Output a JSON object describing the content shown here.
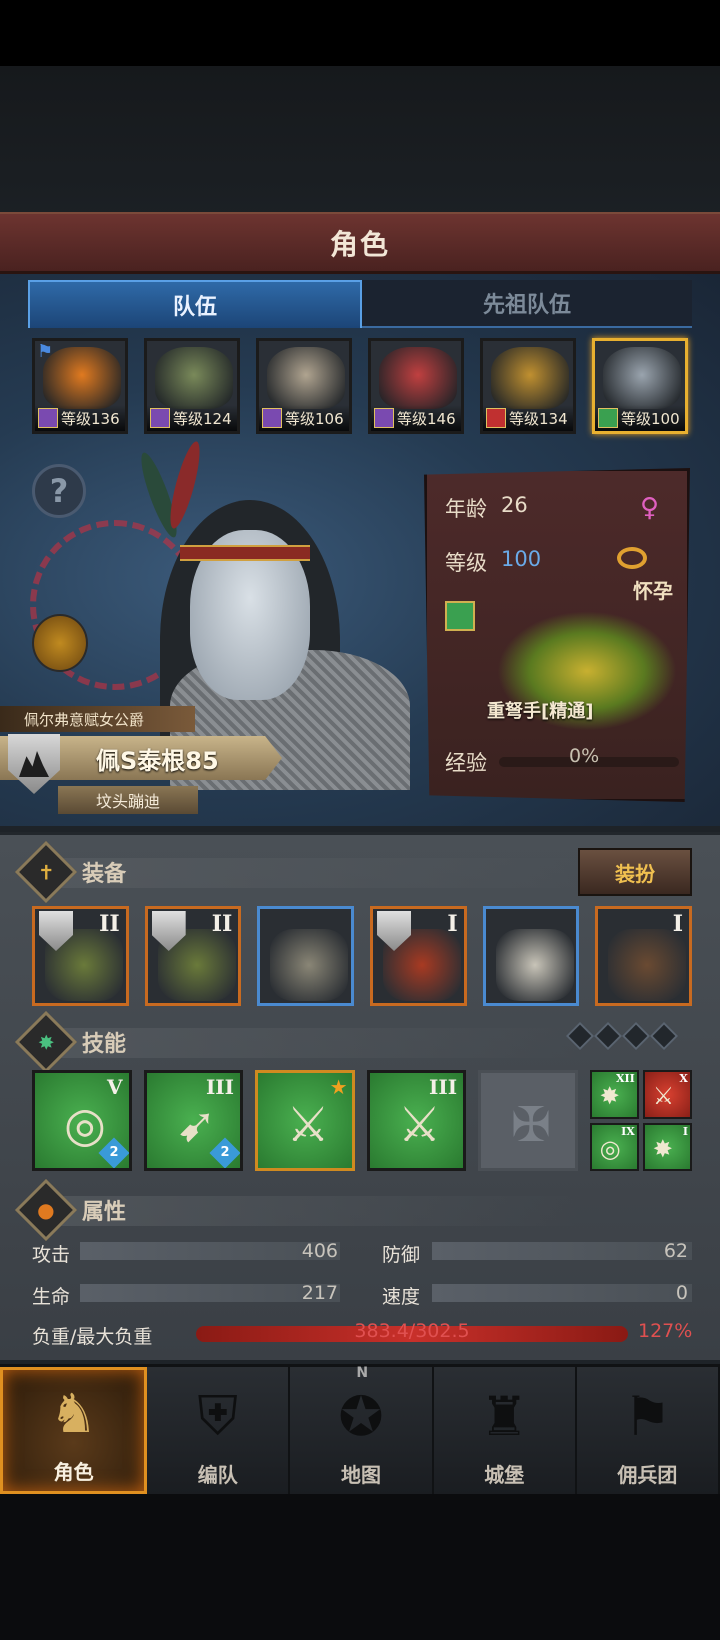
{
  "header": {
    "title": "角色"
  },
  "tabs": [
    {
      "label": "队伍",
      "active": true
    },
    {
      "label": "先祖队伍",
      "active": false
    }
  ],
  "party": [
    {
      "level_text": "等级136",
      "class_color": "#7a4ab0",
      "face_color": "#e07a20",
      "flag": true
    },
    {
      "level_text": "等级124",
      "class_color": "#7a4ab0",
      "face_color": "#7a8a5a",
      "flag": false
    },
    {
      "level_text": "等级106",
      "class_color": "#7a4ab0",
      "face_color": "#b0a490",
      "flag": false
    },
    {
      "level_text": "等级146",
      "class_color": "#7a4ab0",
      "face_color": "#c04040",
      "flag": false
    },
    {
      "level_text": "等级134",
      "class_color": "#c03030",
      "face_color": "#c09030",
      "flag": false
    },
    {
      "level_text": "等级100",
      "class_color": "#3aa050",
      "face_color": "#9aa4ae",
      "flag": false,
      "selected": true
    }
  ],
  "hero": {
    "help_icon": "?",
    "title": "佩尔弗意赋女公爵",
    "name": "佩S泰根85",
    "house": "坟头蹦迪"
  },
  "info": {
    "age_label": "年龄",
    "age": "26",
    "level_label": "等级",
    "level": "100",
    "gender_icon": "♀",
    "status": "怀孕",
    "class_name": "重弩手[精通]",
    "exp_label": "经验",
    "exp_pct": "0%",
    "exp_fraction": 0
  },
  "equipment": {
    "title": "装备",
    "dress_button": "装扮",
    "slots": [
      {
        "roman": "II",
        "shield": true,
        "rarity": "orange",
        "art_color": "#6a7a3a"
      },
      {
        "roman": "II",
        "shield": true,
        "rarity": "orange",
        "art_color": "#6a7a3a"
      },
      {
        "roman": "",
        "shield": false,
        "rarity": "blue",
        "art_color": "#8a8676"
      },
      {
        "roman": "I",
        "shield": true,
        "rarity": "orange",
        "art_color": "#a83a22"
      },
      {
        "roman": "",
        "shield": false,
        "rarity": "blue",
        "art_color": "#c8c4b8"
      },
      {
        "roman": "I",
        "shield": false,
        "rarity": "orange",
        "art_color": "#6a4a32"
      }
    ]
  },
  "skills": {
    "title": "技能",
    "list": [
      {
        "roman": "V",
        "badge": "2",
        "glyph": "◎",
        "star": false,
        "gold": false
      },
      {
        "roman": "III",
        "badge": "2",
        "glyph": "➹",
        "star": false,
        "gold": false
      },
      {
        "roman": "",
        "badge": "",
        "glyph": "⚔",
        "star": true,
        "gold": true
      },
      {
        "roman": "III",
        "badge": "",
        "glyph": "⚔",
        "star": false,
        "gold": false
      }
    ],
    "empty_glyph": "✠",
    "mini": [
      {
        "roman": "XII",
        "glyph": "✸",
        "red": false
      },
      {
        "roman": "X",
        "glyph": "⚔",
        "red": true
      },
      {
        "roman": "IX",
        "glyph": "◎",
        "red": false
      },
      {
        "roman": "I",
        "glyph": "✸",
        "red": false
      }
    ]
  },
  "attributes": {
    "title": "属性",
    "attack_label": "攻击",
    "attack": "406",
    "defense_label": "防御",
    "defense": "62",
    "life_label": "生命",
    "life": "217",
    "speed_label": "速度",
    "speed": "0",
    "load_label": "负重/最大负重",
    "load": "383.4/302.5",
    "load_pct": "127%"
  },
  "nav": [
    {
      "label": "角色",
      "icon": "♞",
      "active": true
    },
    {
      "label": "编队",
      "icon": "⛨",
      "active": false
    },
    {
      "label": "地图",
      "icon": "✪",
      "active": false,
      "north": "N"
    },
    {
      "label": "城堡",
      "icon": "♜",
      "active": false
    },
    {
      "label": "佣兵团",
      "icon": "⚑",
      "active": false
    }
  ]
}
